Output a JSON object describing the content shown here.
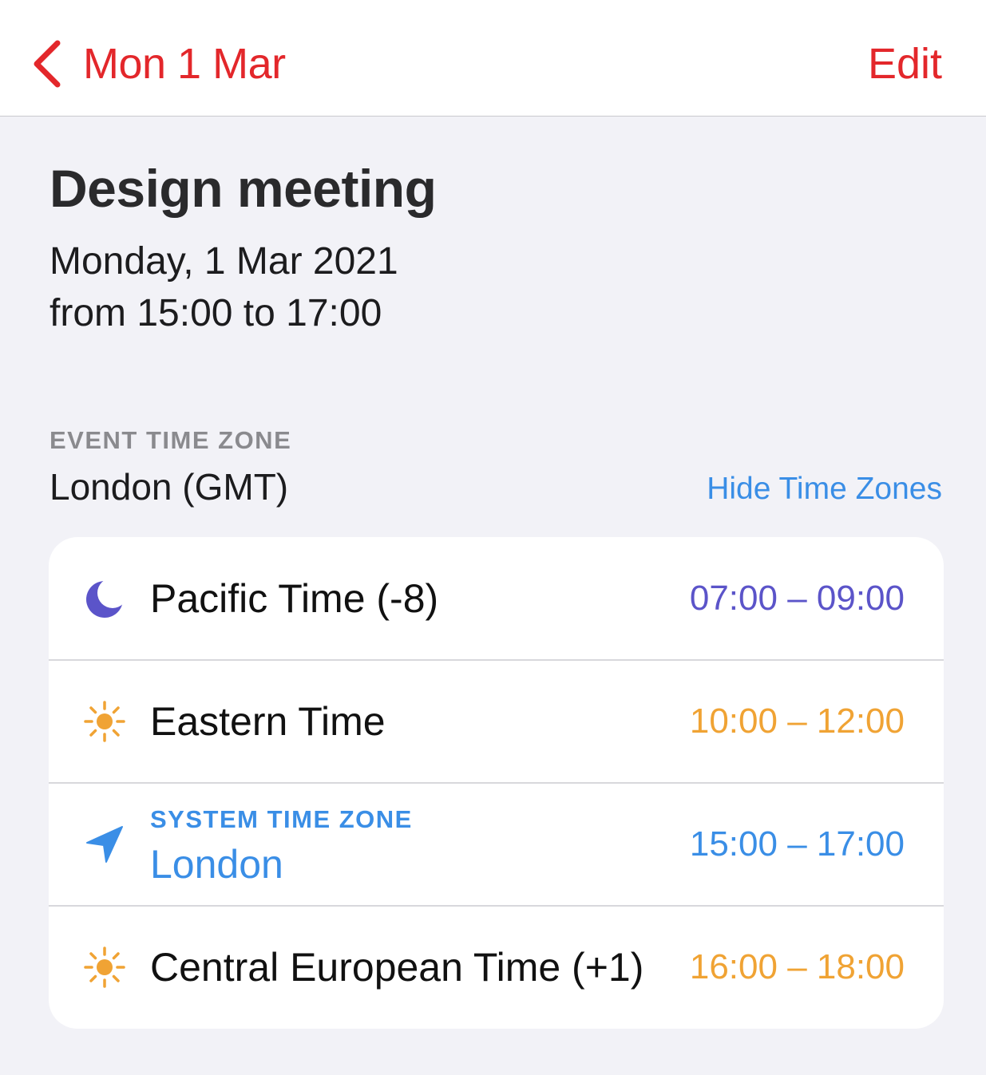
{
  "nav": {
    "back_label": "Mon 1 Mar",
    "edit_label": "Edit"
  },
  "event": {
    "title": "Design meeting",
    "date": "Monday, 1 Mar 2021",
    "time_range": "from 15:00 to 17:00"
  },
  "event_time_zone": {
    "label": "EVENT TIME ZONE",
    "value": "London (GMT)",
    "hide_link": "Hide Time Zones"
  },
  "time_zones": [
    {
      "icon": "moon-icon",
      "name": "Pacific Time (-8)",
      "time": "07:00 – 09:00",
      "color": "#5b54c9"
    },
    {
      "icon": "sun-icon",
      "name": "Eastern Time",
      "time": "10:00 – 12:00",
      "color": "#f0a334"
    },
    {
      "icon": "location-arrow-icon",
      "sublabel": "SYSTEM TIME ZONE",
      "name": "London",
      "time": "15:00 – 17:00",
      "color": "#3a8ee6"
    },
    {
      "icon": "sun-icon",
      "name": "Central European Time (+1)",
      "time": "16:00 – 18:00",
      "color": "#f0a334"
    }
  ],
  "colors": {
    "accent_red": "#e3272b",
    "link_blue": "#3a8ee6",
    "night_purple": "#5b54c9",
    "day_orange": "#f0a334",
    "background": "#f2f2f7"
  }
}
